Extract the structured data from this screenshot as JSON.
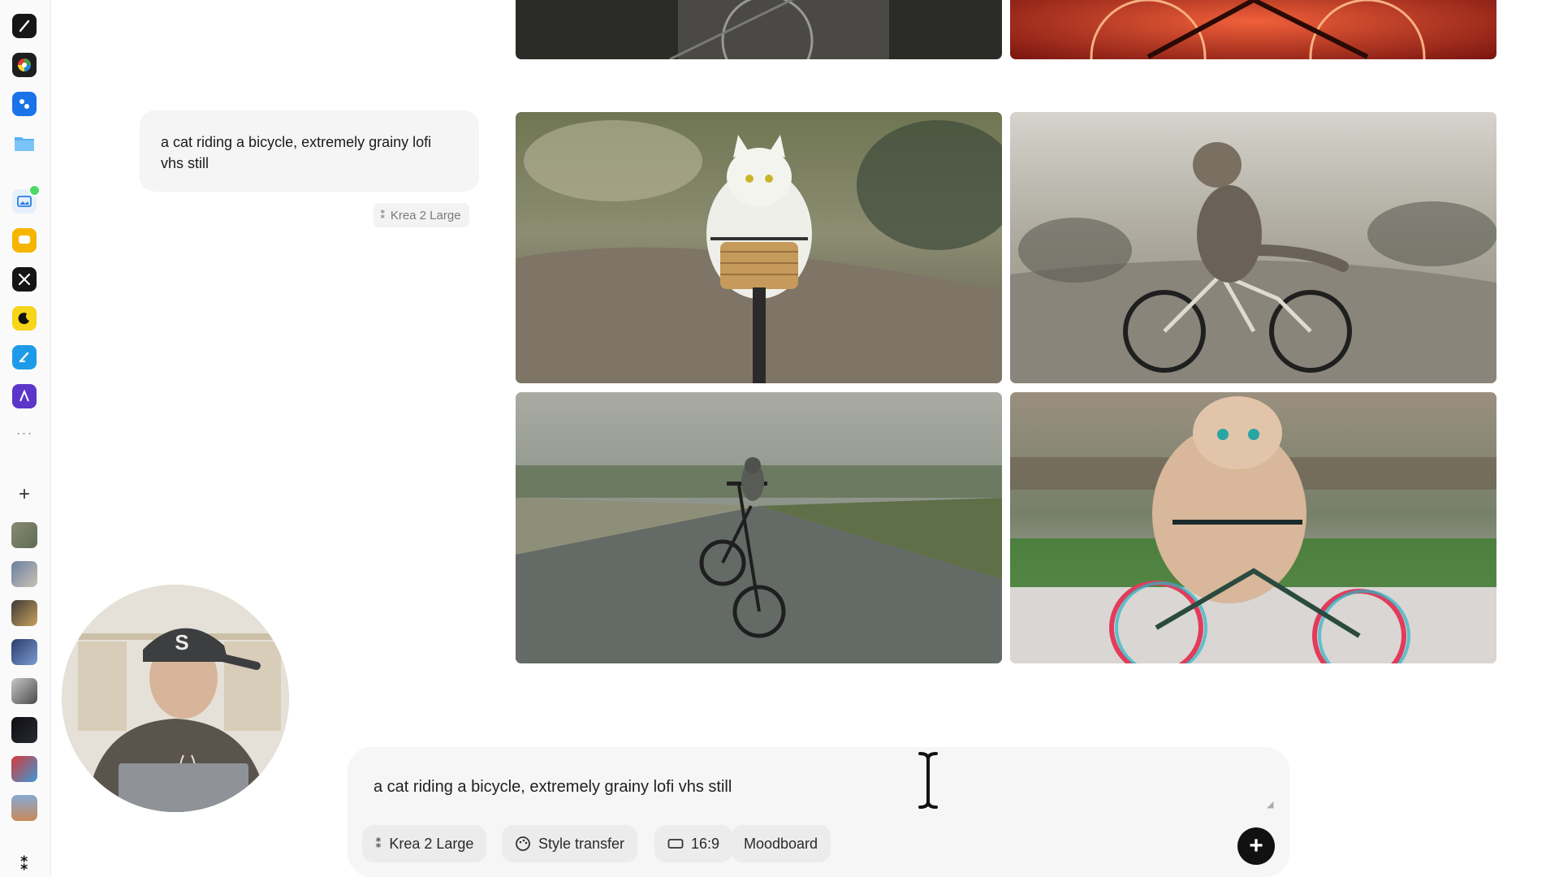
{
  "rail": {
    "icons": [
      {
        "name": "app-pen-icon",
        "color": "#111111"
      },
      {
        "name": "app-color-wheel-icon",
        "color": "#1e1e1e"
      },
      {
        "name": "app-blue-nodes-icon",
        "color": "#1a73e8"
      },
      {
        "name": "app-folder-icon",
        "color": "#5ab1f2"
      },
      {
        "name": "app-gallery-icon",
        "color": "#e8f1fb"
      },
      {
        "name": "app-chat-icon",
        "color": "#f5b400"
      },
      {
        "name": "app-tools-icon",
        "color": "#111111"
      },
      {
        "name": "app-moon-icon",
        "color": "#f7d51a"
      },
      {
        "name": "app-brush-icon",
        "color": "#1e9be8"
      },
      {
        "name": "app-purple-a-icon",
        "color": "#5a36c9"
      }
    ],
    "more_label": "···",
    "add_label": "+",
    "krea_logo": "⁑"
  },
  "conversation": {
    "prompt_text": "a cat riding a bicycle, extremely grainy lofi vhs still",
    "model_chip": "Krea 2 Large"
  },
  "composer": {
    "input_value": "a cat riding a bicycle, extremely grainy lofi vhs still",
    "chips": {
      "model": "Krea 2 Large",
      "style": "Style transfer",
      "ratio": "16:9",
      "moodboard": "Moodboard"
    },
    "send_icon": "+"
  }
}
